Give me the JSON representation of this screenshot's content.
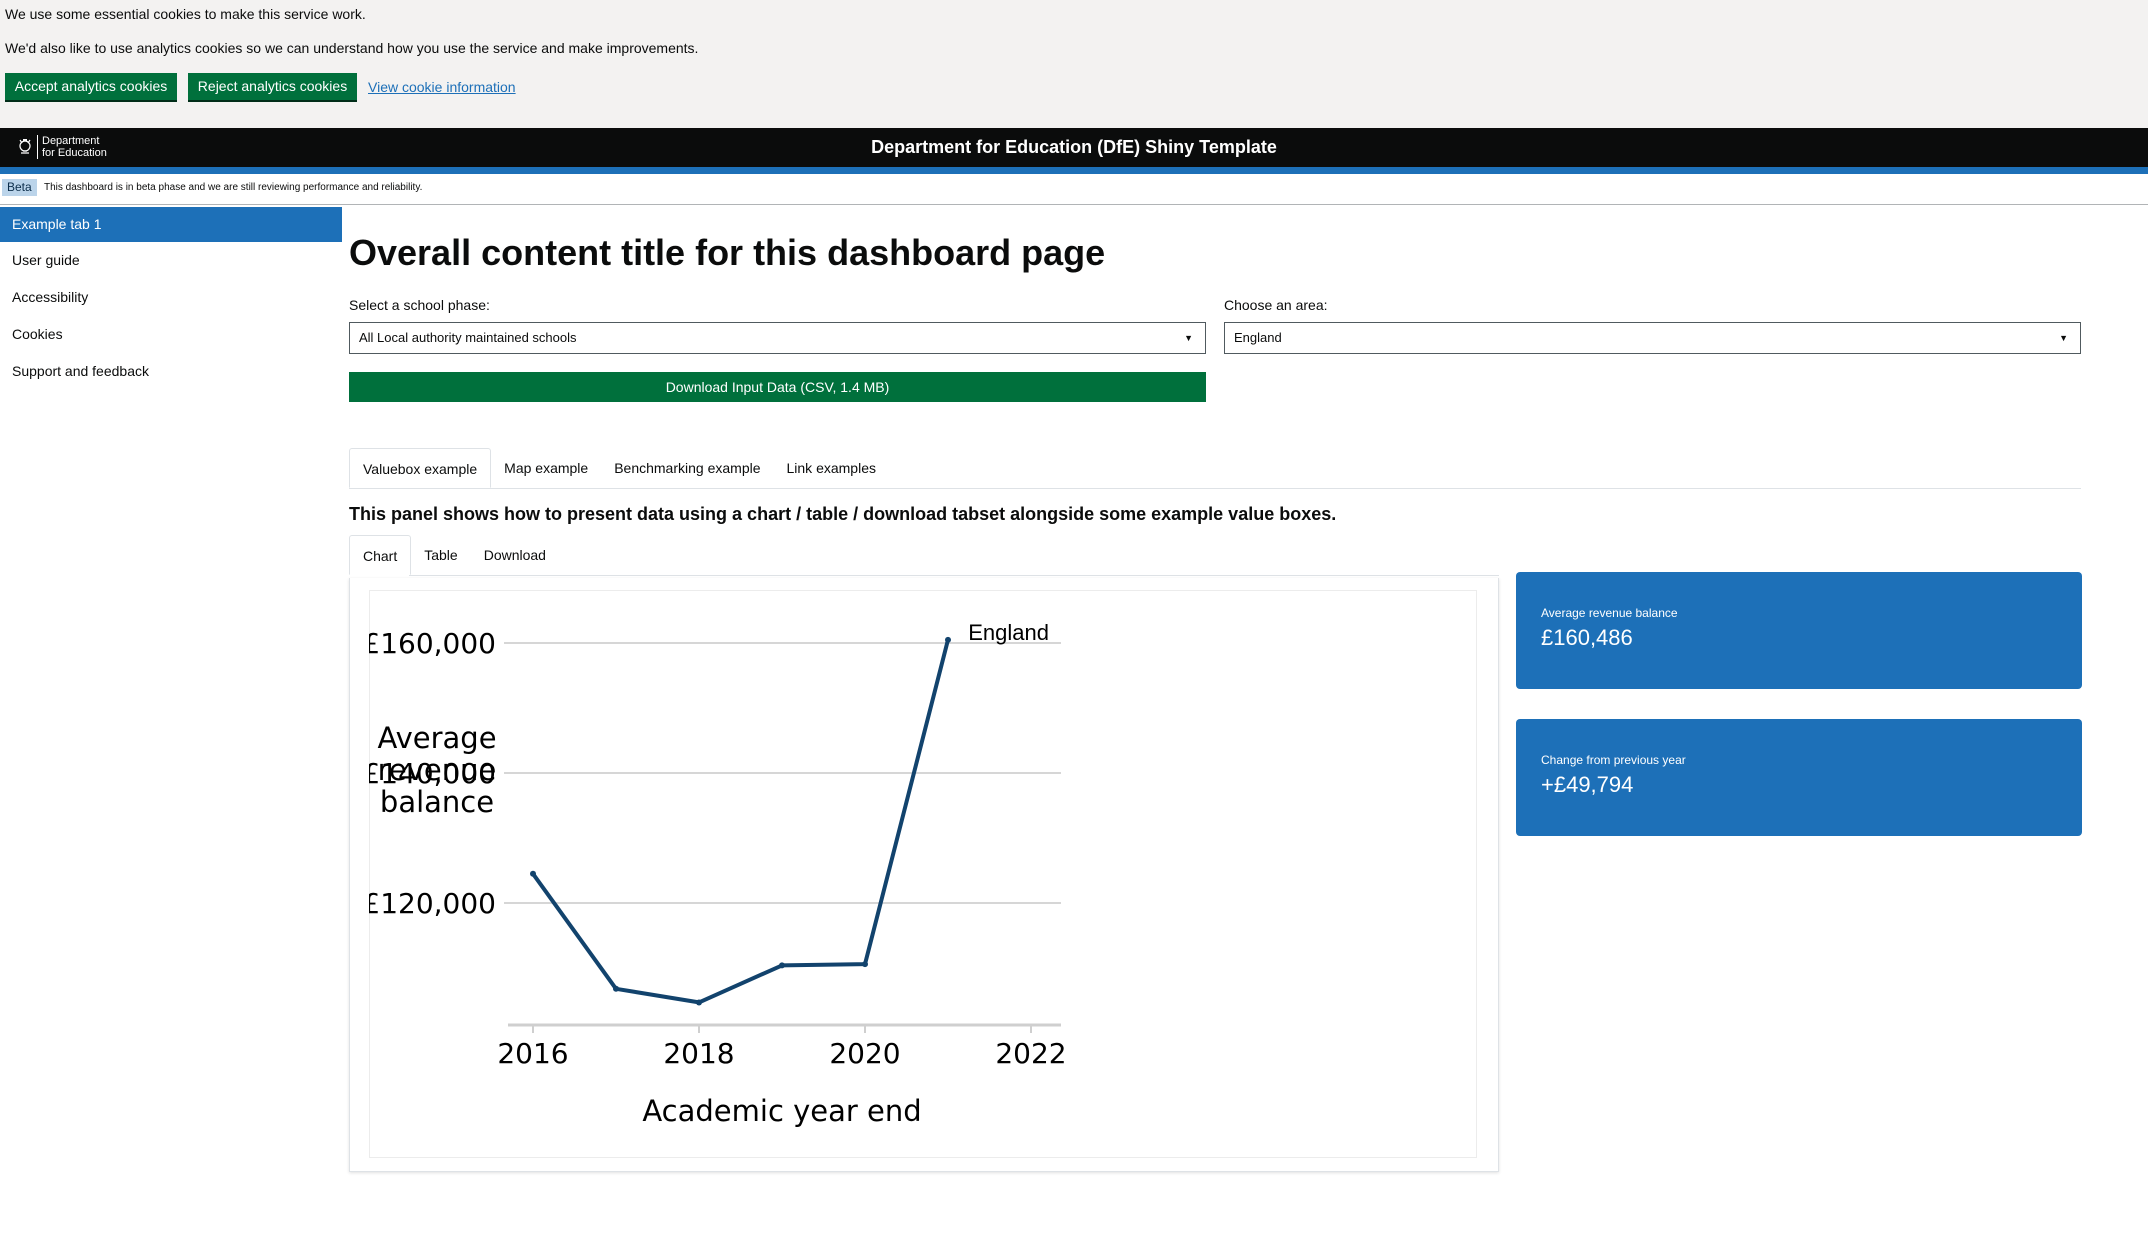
{
  "cookie_banner": {
    "line1": "We use some essential cookies to make this service work.",
    "line2": "We'd also like to use analytics cookies so we can understand how you use the service and make improvements.",
    "accept_label": "Accept analytics cookies",
    "reject_label": "Reject analytics cookies",
    "view_link": "View cookie information"
  },
  "header": {
    "logo_line1": "Department",
    "logo_line2": "for Education",
    "title": "Department for Education (DfE) Shiny Template"
  },
  "beta": {
    "tag": "Beta",
    "text": "This dashboard is in beta phase and we are still reviewing performance and reliability."
  },
  "sidebar": {
    "items": [
      {
        "label": "Example tab 1"
      },
      {
        "label": "User guide"
      },
      {
        "label": "Accessibility"
      },
      {
        "label": "Cookies"
      },
      {
        "label": "Support and feedback"
      }
    ]
  },
  "main": {
    "title": "Overall content title for this dashboard page",
    "phase_label": "Select a school phase:",
    "phase_value": "All Local authority maintained schools",
    "area_label": "Choose an area:",
    "area_value": "England",
    "download_label": "Download Input Data (CSV, 1.4 MB)",
    "tabs": [
      {
        "label": "Valuebox example"
      },
      {
        "label": "Map example"
      },
      {
        "label": "Benchmarking example"
      },
      {
        "label": "Link examples"
      }
    ],
    "panel_text": "This panel shows how to present data using a chart / table / download tabset alongside some example value boxes.",
    "subtabs": [
      {
        "label": "Chart"
      },
      {
        "label": "Table"
      },
      {
        "label": "Download"
      }
    ]
  },
  "valueboxes": [
    {
      "title": "Average revenue balance",
      "value": "£160,486"
    },
    {
      "title": "Change from previous year",
      "value": "+£49,794"
    }
  ],
  "chart_data": {
    "type": "line",
    "xlabel": "Academic year end",
    "ylabel": "Average revenue balance",
    "x_ticks": [
      "2016",
      "2018",
      "2020",
      "2022"
    ],
    "y_ticks": [
      "£120,000",
      "£140,000",
      "£160,000"
    ],
    "xlim": [
      2016,
      2022
    ],
    "ylim": [
      102000,
      162000
    ],
    "grid": "horizontal",
    "line_color": "#12436d",
    "series": [
      {
        "name": "England",
        "x": [
          2016,
          2017,
          2018,
          2019,
          2020,
          2021
        ],
        "y": [
          124500,
          106800,
          104700,
          110400,
          110600,
          160486
        ]
      }
    ]
  }
}
